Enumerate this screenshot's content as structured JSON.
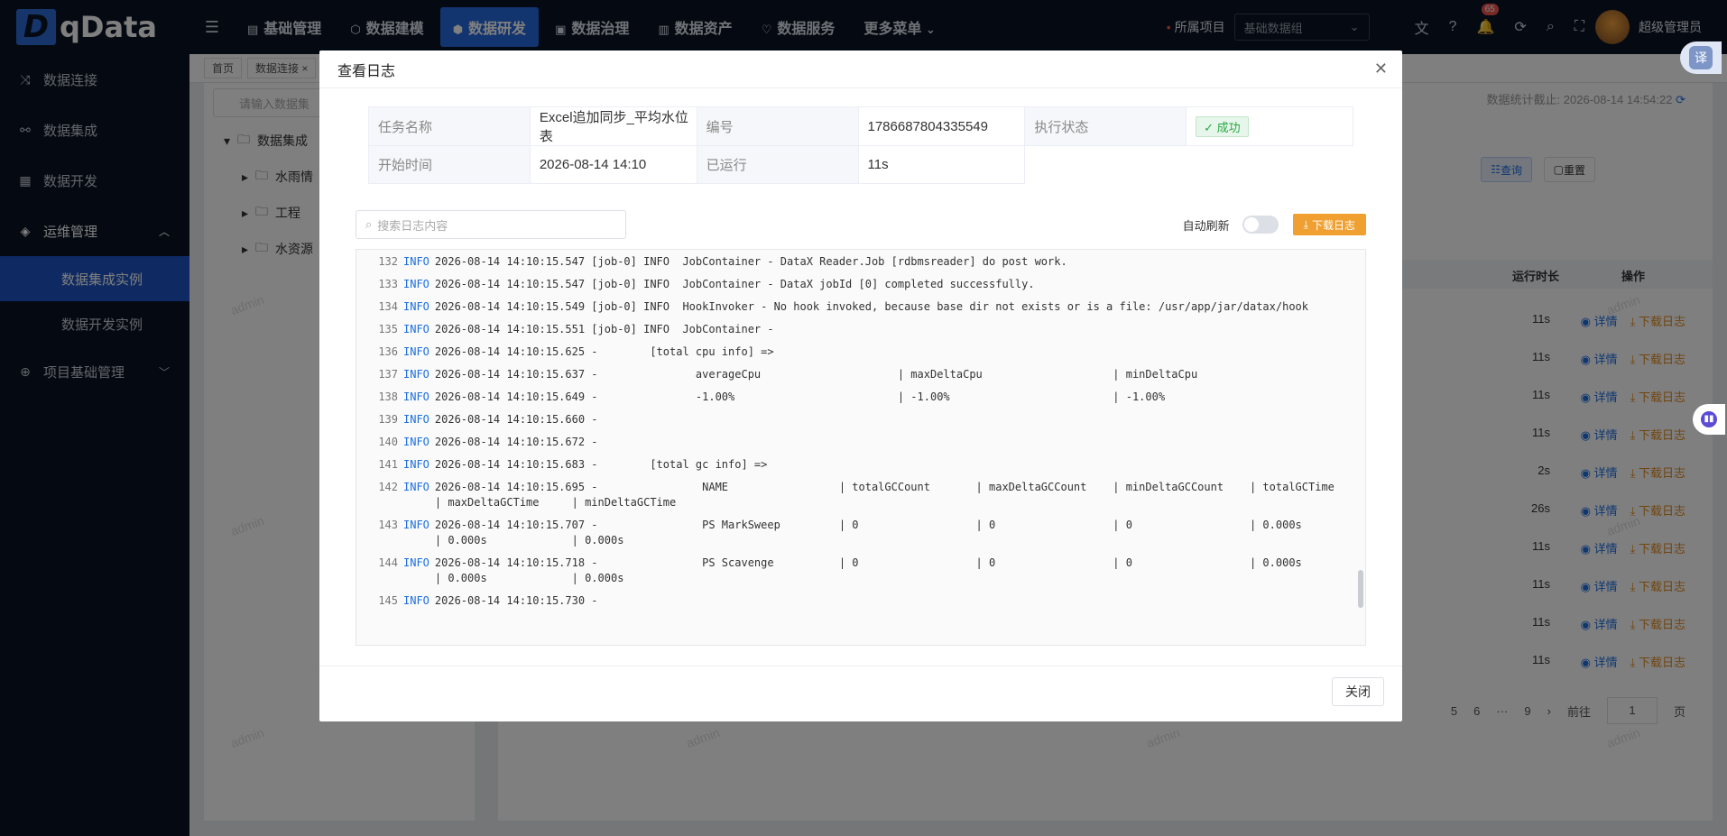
{
  "app": {
    "logo_text": "qData",
    "logo_mark": "D"
  },
  "sidebar": {
    "items": [
      {
        "label": "数据连接",
        "icon": "shuffle-icon"
      },
      {
        "label": "数据集成",
        "icon": "nodes-icon"
      },
      {
        "label": "数据开发",
        "icon": "chart-icon"
      },
      {
        "label": "运维管理",
        "icon": "box-icon"
      },
      {
        "label": "数据集成实例"
      },
      {
        "label": "数据开发实例"
      },
      {
        "label": "项目基础管理",
        "icon": "globe-icon"
      }
    ]
  },
  "topnav": {
    "items": [
      "基础管理",
      "数据建模",
      "数据研发",
      "数据治理",
      "数据资产",
      "数据服务",
      "更多菜单"
    ],
    "active": "数据研发"
  },
  "header": {
    "project_label": "所属项目",
    "project_value": "基础数据组",
    "notif_count": "65",
    "user_name": "超级管理员"
  },
  "tabs": {
    "home": "首页",
    "current": "数据连接"
  },
  "left": {
    "search_placeholder": "请输入数据集",
    "tree": [
      "数据集成",
      "水雨情",
      "工程",
      "水资源"
    ]
  },
  "right": {
    "stat_text": "数据统计截止: 2026-08-14 14:54:22",
    "query_btn": "查询",
    "reset_btn": "重置",
    "col_duration": "运行时长",
    "col_ops": "操作",
    "durations": [
      "11s",
      "11s",
      "11s",
      "11s",
      "2s",
      "26s",
      "11s",
      "11s",
      "11s",
      "11s"
    ],
    "op_detail": "详情",
    "op_download": "下载日志",
    "pager": {
      "pages": [
        "5",
        "6",
        "···",
        "9"
      ],
      "goto": "前往",
      "current": "1",
      "unit": "页"
    }
  },
  "watermark": "admin",
  "modal": {
    "title": "查看日志",
    "info": {
      "task_name_label": "任务名称",
      "task_name": "Excel追加同步_平均水位表",
      "id_label": "编号",
      "id": "1786687804335549",
      "status_label": "执行状态",
      "status": "成功",
      "start_label": "开始时间",
      "start": "2026-08-14 14:10",
      "elapsed_label": "已运行",
      "elapsed": "11s"
    },
    "search_placeholder": "搜索日志内容",
    "auto_refresh": "自动刷新",
    "download_btn": "下载日志",
    "close_btn": "关闭",
    "logs": [
      {
        "n": "132",
        "lv": "INFO",
        "t": "2026-08-14 14:10:15.547 [job-0] INFO  JobContainer - DataX Reader.Job [rdbmsreader] do post work."
      },
      {
        "n": "133",
        "lv": "INFO",
        "t": "2026-08-14 14:10:15.547 [job-0] INFO  JobContainer - DataX jobId [0] completed successfully."
      },
      {
        "n": "134",
        "lv": "INFO",
        "t": "2026-08-14 14:10:15.549 [job-0] INFO  HookInvoker - No hook invoked, because base dir not exists or is a file: /usr/app/jar/datax/hook"
      },
      {
        "n": "135",
        "lv": "INFO",
        "t": "2026-08-14 14:10:15.551 [job-0] INFO  JobContainer -"
      },
      {
        "n": "136",
        "lv": "INFO",
        "t": "2026-08-14 14:10:15.625 -        [total cpu info] =>"
      },
      {
        "n": "137",
        "lv": "INFO",
        "t": "2026-08-14 14:10:15.637 -               averageCpu                     | maxDeltaCpu                    | minDeltaCpu"
      },
      {
        "n": "138",
        "lv": "INFO",
        "t": "2026-08-14 14:10:15.649 -               -1.00%                         | -1.00%                         | -1.00%"
      },
      {
        "n": "139",
        "lv": "INFO",
        "t": "2026-08-14 14:10:15.660 -"
      },
      {
        "n": "140",
        "lv": "INFO",
        "t": "2026-08-14 14:10:15.672 -"
      },
      {
        "n": "141",
        "lv": "INFO",
        "t": "2026-08-14 14:10:15.683 -        [total gc info] =>"
      },
      {
        "n": "142",
        "lv": "INFO",
        "t": "2026-08-14 14:10:15.695 -                NAME                 | totalGCCount       | maxDeltaGCCount    | minDeltaGCCount    | totalGCTime        | maxDeltaGCTime     | minDeltaGCTime"
      },
      {
        "n": "143",
        "lv": "INFO",
        "t": "2026-08-14 14:10:15.707 -                PS MarkSweep         | 0                  | 0                  | 0                  | 0.000s             | 0.000s             | 0.000s"
      },
      {
        "n": "144",
        "lv": "INFO",
        "t": "2026-08-14 14:10:15.718 -                PS Scavenge          | 0                  | 0                  | 0                  | 0.000s             | 0.000s             | 0.000s"
      },
      {
        "n": "145",
        "lv": "INFO",
        "t": "2026-08-14 14:10:15.730 -"
      }
    ]
  },
  "floating": {
    "translate_label": "译"
  }
}
